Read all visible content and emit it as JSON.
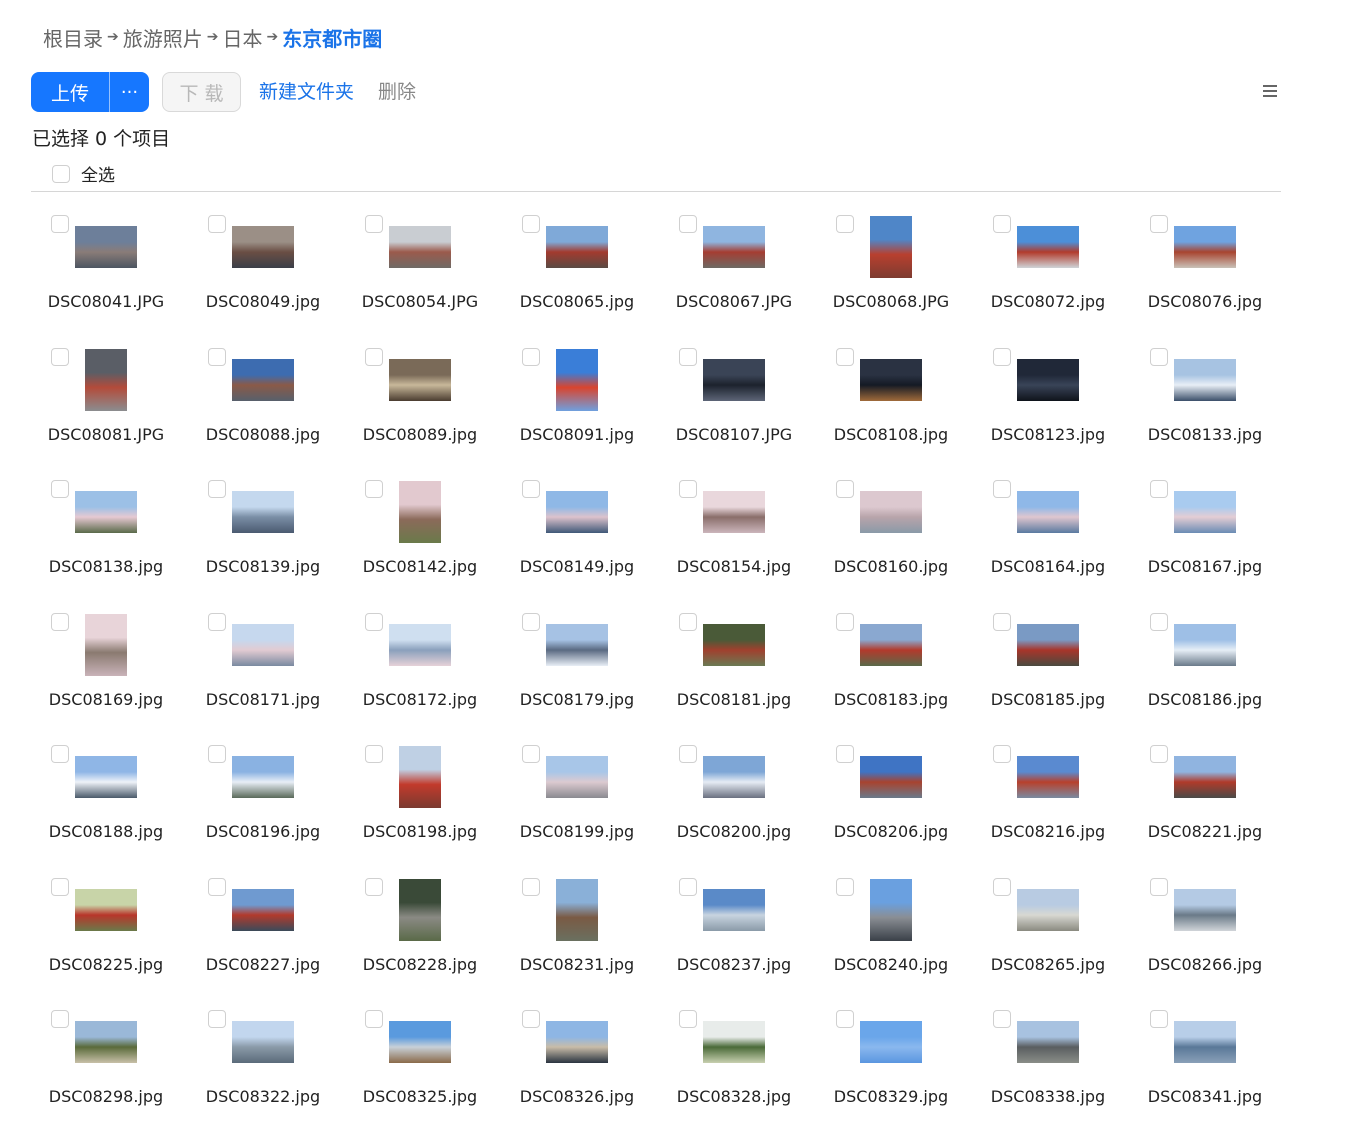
{
  "breadcrumb": [
    {
      "label": "根目录"
    },
    {
      "label": "旅游照片"
    },
    {
      "label": "日本"
    },
    {
      "label": "东京都市圈",
      "current": true
    }
  ],
  "toolbar": {
    "upload_label": "上传",
    "more_label": "···",
    "download_label": "下 载",
    "new_folder_label": "新建文件夹",
    "delete_label": "删除"
  },
  "selection": {
    "count_text": "已选择 0 个项目",
    "select_all_label": "全选"
  },
  "colors": {
    "accent": "#1677ff",
    "link": "#1a73e8"
  },
  "files": [
    {
      "name": "DSC08041.JPG",
      "orientation": "landscape",
      "colors": [
        "#6d7f9a",
        "#8a7c78",
        "#4c5561"
      ]
    },
    {
      "name": "DSC08049.jpg",
      "orientation": "landscape",
      "colors": [
        "#9b8f86",
        "#6a4e44",
        "#3a3f48"
      ]
    },
    {
      "name": "DSC08054.JPG",
      "orientation": "landscape",
      "colors": [
        "#c9cdd2",
        "#9b5a4c",
        "#6f6a66"
      ]
    },
    {
      "name": "DSC08065.jpg",
      "orientation": "landscape",
      "colors": [
        "#7fa9d8",
        "#a33a2e",
        "#5a4a44"
      ]
    },
    {
      "name": "DSC08067.JPG",
      "orientation": "landscape",
      "colors": [
        "#8fb5e0",
        "#a53d32",
        "#6d6a64"
      ]
    },
    {
      "name": "DSC08068.JPG",
      "orientation": "portrait",
      "colors": [
        "#4f86c8",
        "#b8402f",
        "#7d3b30"
      ]
    },
    {
      "name": "DSC08072.jpg",
      "orientation": "landscape",
      "colors": [
        "#4c8fd8",
        "#b23b2c",
        "#cfd4d8"
      ]
    },
    {
      "name": "DSC08076.jpg",
      "orientation": "landscape",
      "colors": [
        "#6fa3e0",
        "#a8442f",
        "#c9c2b8"
      ]
    },
    {
      "name": "DSC08081.JPG",
      "orientation": "portrait",
      "colors": [
        "#5a5e66",
        "#b34b3a",
        "#8b8d90"
      ]
    },
    {
      "name": "DSC08088.jpg",
      "orientation": "landscape",
      "colors": [
        "#3d6cb0",
        "#8a5a48",
        "#57606c"
      ]
    },
    {
      "name": "DSC08089.jpg",
      "orientation": "landscape",
      "colors": [
        "#7a6a58",
        "#c8b89a",
        "#4a3c30"
      ]
    },
    {
      "name": "DSC08091.jpg",
      "orientation": "portrait",
      "colors": [
        "#3a7ed8",
        "#d9442e",
        "#6fa0df"
      ]
    },
    {
      "name": "DSC08107.JPG",
      "orientation": "landscape",
      "colors": [
        "#3a4456",
        "#1c222d",
        "#5d6577"
      ]
    },
    {
      "name": "DSC08108.jpg",
      "orientation": "landscape",
      "colors": [
        "#2a3242",
        "#141a24",
        "#a06a3a"
      ]
    },
    {
      "name": "DSC08123.jpg",
      "orientation": "landscape",
      "colors": [
        "#202838",
        "#394458",
        "#0f131b"
      ]
    },
    {
      "name": "DSC08133.jpg",
      "orientation": "landscape",
      "colors": [
        "#a7c3e2",
        "#e8eef6",
        "#3b4f6a"
      ]
    },
    {
      "name": "DSC08138.jpg",
      "orientation": "landscape",
      "colors": [
        "#9cc0e6",
        "#e6c9d2",
        "#5a6a4a"
      ]
    },
    {
      "name": "DSC08139.jpg",
      "orientation": "landscape",
      "colors": [
        "#c4d8ee",
        "#7a8ea6",
        "#4a5a70"
      ]
    },
    {
      "name": "DSC08142.jpg",
      "orientation": "portrait",
      "colors": [
        "#e2c9cf",
        "#8b6a5a",
        "#6a7a4a"
      ]
    },
    {
      "name": "DSC08149.jpg",
      "orientation": "landscape",
      "colors": [
        "#8fb8e6",
        "#dcc2cc",
        "#3f5878"
      ]
    },
    {
      "name": "DSC08154.jpg",
      "orientation": "landscape",
      "colors": [
        "#e9d7dc",
        "#8a6e6a",
        "#cbb5bb"
      ]
    },
    {
      "name": "DSC08160.jpg",
      "orientation": "landscape",
      "colors": [
        "#dcc8cf",
        "#b8a4aa",
        "#8a9aa8"
      ]
    },
    {
      "name": "DSC08164.jpg",
      "orientation": "landscape",
      "colors": [
        "#8fb8e8",
        "#dfc6cf",
        "#5a7aa0"
      ]
    },
    {
      "name": "DSC08167.jpg",
      "orientation": "landscape",
      "colors": [
        "#a9cbef",
        "#e4cdd4",
        "#6a8cb4"
      ]
    },
    {
      "name": "DSC08169.jpg",
      "orientation": "portrait",
      "colors": [
        "#e8d4d9",
        "#8a7a70",
        "#c9b3b9"
      ]
    },
    {
      "name": "DSC08171.jpg",
      "orientation": "landscape",
      "colors": [
        "#c6d8ee",
        "#e2cbd2",
        "#7a8aa0"
      ]
    },
    {
      "name": "DSC08172.jpg",
      "orientation": "landscape",
      "colors": [
        "#cfdff0",
        "#8aa0bc",
        "#e6d2d8"
      ]
    },
    {
      "name": "DSC08179.jpg",
      "orientation": "landscape",
      "colors": [
        "#a6c2e4",
        "#5a6a82",
        "#e8eef6"
      ]
    },
    {
      "name": "DSC08181.jpg",
      "orientation": "landscape",
      "colors": [
        "#4a5a38",
        "#a0402e",
        "#6a7a54"
      ]
    },
    {
      "name": "DSC08183.jpg",
      "orientation": "landscape",
      "colors": [
        "#8aa8d0",
        "#b33a2c",
        "#5a6a4a"
      ]
    },
    {
      "name": "DSC08185.jpg",
      "orientation": "landscape",
      "colors": [
        "#7a9ac4",
        "#a8352a",
        "#4a4a40"
      ]
    },
    {
      "name": "DSC08186.jpg",
      "orientation": "landscape",
      "colors": [
        "#9ebfe6",
        "#e6eef6",
        "#6a7a8a"
      ]
    },
    {
      "name": "DSC08188.jpg",
      "orientation": "landscape",
      "colors": [
        "#8fb6e6",
        "#eef2f8",
        "#4a5a6a"
      ]
    },
    {
      "name": "DSC08196.jpg",
      "orientation": "landscape",
      "colors": [
        "#8ab2e2",
        "#e8eef6",
        "#5a6a5a"
      ]
    },
    {
      "name": "DSC08198.jpg",
      "orientation": "portrait",
      "colors": [
        "#bfd0e4",
        "#c23a2c",
        "#7a3a30"
      ]
    },
    {
      "name": "DSC08199.jpg",
      "orientation": "landscape",
      "colors": [
        "#a8c6e8",
        "#dccad0",
        "#8a8a90"
      ]
    },
    {
      "name": "DSC08200.jpg",
      "orientation": "landscape",
      "colors": [
        "#7ea6d6",
        "#e6ecf4",
        "#6a7080"
      ]
    },
    {
      "name": "DSC08206.jpg",
      "orientation": "landscape",
      "colors": [
        "#3f74c4",
        "#a8432f",
        "#6a7a8a"
      ]
    },
    {
      "name": "DSC08216.jpg",
      "orientation": "landscape",
      "colors": [
        "#5a8ad0",
        "#b8402c",
        "#7a8aa0"
      ]
    },
    {
      "name": "DSC08221.jpg",
      "orientation": "landscape",
      "colors": [
        "#90b4e0",
        "#b03a2a",
        "#4a4a48"
      ]
    },
    {
      "name": "DSC08225.jpg",
      "orientation": "landscape",
      "colors": [
        "#c8d4a8",
        "#b8352a",
        "#6a7a4a"
      ]
    },
    {
      "name": "DSC08227.jpg",
      "orientation": "landscape",
      "colors": [
        "#6f9ad0",
        "#b23a2c",
        "#3a4a5a"
      ]
    },
    {
      "name": "DSC08228.jpg",
      "orientation": "portrait",
      "colors": [
        "#3a4a38",
        "#8a8a84",
        "#5a6a48"
      ]
    },
    {
      "name": "DSC08231.jpg",
      "orientation": "portrait",
      "colors": [
        "#8ab0d8",
        "#7a5a44",
        "#6a7060"
      ]
    },
    {
      "name": "DSC08237.jpg",
      "orientation": "landscape",
      "colors": [
        "#5a8ac8",
        "#c8d4e0",
        "#8a9aa8"
      ]
    },
    {
      "name": "DSC08240.jpg",
      "orientation": "portrait",
      "colors": [
        "#6aa0e0",
        "#8a8e94",
        "#3a4048"
      ]
    },
    {
      "name": "DSC08265.jpg",
      "orientation": "landscape",
      "colors": [
        "#b8cbe2",
        "#d8d8d2",
        "#8a8a80"
      ]
    },
    {
      "name": "DSC08266.jpg",
      "orientation": "landscape",
      "colors": [
        "#b4cae4",
        "#6a7a88",
        "#d0d4d8"
      ]
    },
    {
      "name": "DSC08298.jpg",
      "orientation": "landscape",
      "colors": [
        "#9ab8d8",
        "#5a6a3a",
        "#c8c0a8"
      ]
    },
    {
      "name": "DSC08322.jpg",
      "orientation": "landscape",
      "colors": [
        "#c2d6ee",
        "#8a9aa8",
        "#5a6a7a"
      ]
    },
    {
      "name": "DSC08325.jpg",
      "orientation": "landscape",
      "colors": [
        "#5a9ade",
        "#c8d0d8",
        "#8a6a4a"
      ]
    },
    {
      "name": "DSC08326.jpg",
      "orientation": "landscape",
      "colors": [
        "#8eb6e4",
        "#c8bca8",
        "#2a3440"
      ]
    },
    {
      "name": "DSC08328.jpg",
      "orientation": "landscape",
      "colors": [
        "#e8ecea",
        "#4a6a38",
        "#c8d0b0"
      ]
    },
    {
      "name": "DSC08329.jpg",
      "orientation": "landscape",
      "colors": [
        "#6aa6ea",
        "#8ab8ee",
        "#5a96e0"
      ]
    },
    {
      "name": "DSC08338.jpg",
      "orientation": "landscape",
      "colors": [
        "#a8c2e0",
        "#5a5e60",
        "#8a8e88"
      ]
    },
    {
      "name": "DSC08341.jpg",
      "orientation": "landscape",
      "colors": [
        "#b8cee8",
        "#5a7898",
        "#8aa0b8"
      ]
    }
  ]
}
